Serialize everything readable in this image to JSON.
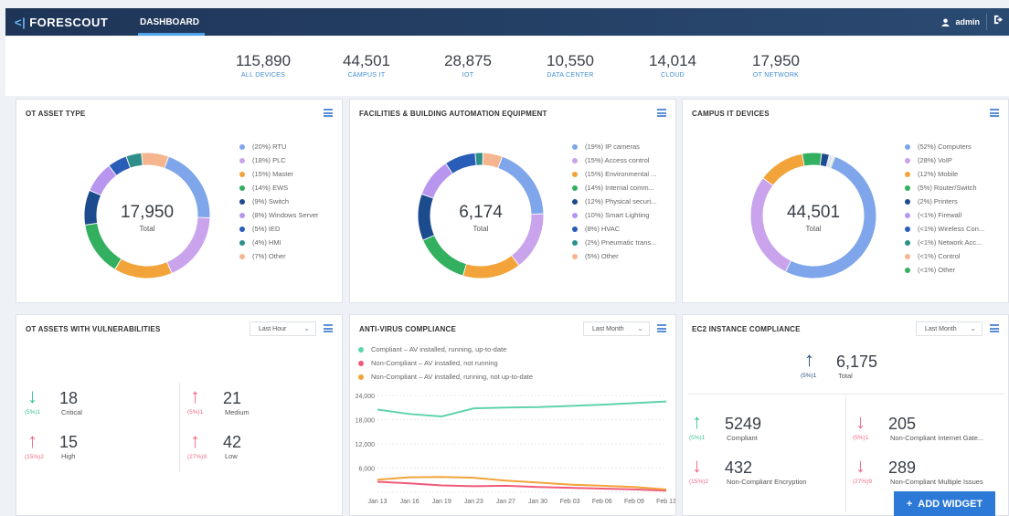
{
  "nav": {
    "brand": "FORESCOUT",
    "brand_glyph": "<|",
    "tab": "DASHBOARD",
    "user": "admin"
  },
  "stats": [
    {
      "value": "115,890",
      "label": "ALL DEVICES"
    },
    {
      "value": "44,501",
      "label": "CAMPUS IT"
    },
    {
      "value": "28,875",
      "label": "IOT"
    },
    {
      "value": "10,550",
      "label": "DATA CENTER"
    },
    {
      "value": "14,014",
      "label": "CLOUD"
    },
    {
      "value": "17,950",
      "label": "OT NETWORK"
    }
  ],
  "ot_asset": {
    "title": "OT ASSET TYPE",
    "total": "17,950",
    "total_label": "Total",
    "legend": [
      "(20%) RTU",
      "(18%) PLC",
      "(15%) Master",
      "(14%) EWS",
      "(9%) Switch",
      "(8%) Windows Server",
      "(5%) IED",
      "(4%) HMI",
      "(7%) Other"
    ],
    "values": [
      20,
      18,
      15,
      14,
      9,
      8,
      5,
      4,
      7
    ],
    "colors": [
      "#7fa6ea",
      "#c9a3ec",
      "#f2a43a",
      "#33b05f",
      "#1c4b8e",
      "#b895ee",
      "#2a5db8",
      "#2e8f8a",
      "#f5b58f"
    ]
  },
  "facilities": {
    "title": "FACILITIES & BUILDING AUTOMATION EQUIPMENT",
    "total": "6,174",
    "total_label": "Total",
    "legend": [
      "(19%) IP cameras",
      "(15%) Access control",
      "(15%) Environmental ...",
      "(14%) Internal comm...",
      "(12%) Physical securi...",
      "(10%) Smart Lighting",
      "(8%) HVAC",
      "(2%) Pneumatic trans...",
      "(5%) Other"
    ],
    "values": [
      19,
      15,
      15,
      14,
      12,
      10,
      8,
      2,
      5
    ],
    "colors": [
      "#7fa6ea",
      "#c9a3ec",
      "#f2a43a",
      "#33b05f",
      "#1c4b8e",
      "#b895ee",
      "#2a5db8",
      "#2e8f8a",
      "#f5b58f"
    ]
  },
  "campus": {
    "title": "CAMPUS IT DEVICES",
    "total": "44,501",
    "total_label": "Total",
    "legend": [
      "(52%) Computers",
      "(28%) VoIP",
      "(12%) Mobile",
      "(5%) Router/Switch",
      "(2%) Printers",
      "(<1%) Firewall",
      "(<1%) Wireless Con...",
      "(<1%) Network Acc...",
      "(<1%) Control",
      "(<1%) Other"
    ],
    "values": [
      52,
      28,
      12,
      5,
      2,
      0.3,
      0.3,
      0.3,
      0.3,
      0.3
    ],
    "colors": [
      "#7fa6ea",
      "#c9a3ec",
      "#f2a43a",
      "#33b05f",
      "#1c4b8e",
      "#b895ee",
      "#2a5db8",
      "#2e8f8a",
      "#f5b58f",
      "#33b05f"
    ]
  },
  "vuln": {
    "title": "OT ASSETS WITH VULNERABILITIES",
    "dropdown": "Last Hour",
    "items": [
      {
        "value": "18",
        "label": "Critical",
        "pct": "(5%)1",
        "dir": "down"
      },
      {
        "value": "21",
        "label": "Medium",
        "pct": "(5%)1",
        "dir": "up"
      },
      {
        "value": "15",
        "label": "High",
        "pct": "(15%)2",
        "dir": "up"
      },
      {
        "value": "42",
        "label": "Low",
        "pct": "(27%)9",
        "dir": "up"
      }
    ]
  },
  "av": {
    "title": "ANTI-VIRUS COMPLIANCE",
    "dropdown": "Last Month",
    "legend": [
      "Compliant – AV installed, running, up-to-date",
      "Non-Compliant – AV installed, not running",
      "Non-Compliant – AV installed, running, not up-to-date"
    ],
    "legend_colors": [
      "#5fd3a9",
      "#ef5b7a",
      "#f2a43a"
    ]
  },
  "chart_data": {
    "type": "line",
    "x": [
      "Jan 13",
      "Jan 16",
      "Jan 19",
      "Jan 23",
      "Jan 27",
      "Jan 30",
      "Feb 03",
      "Feb 06",
      "Feb 09",
      "Feb 13"
    ],
    "ylim": [
      0,
      24000
    ],
    "yticks": [
      "24,000",
      "18,000",
      "12,000",
      "6,000"
    ],
    "series": [
      {
        "values": [
          20500,
          19400,
          18800,
          20800,
          21000,
          21100,
          21400,
          21700,
          22100,
          22500
        ],
        "color": "#5fd3a9"
      },
      {
        "values": [
          2600,
          2200,
          1700,
          1500,
          1600,
          1300,
          1100,
          900,
          700,
          400
        ],
        "color": "#ef5b7a"
      },
      {
        "values": [
          3100,
          3700,
          3800,
          3600,
          2900,
          2400,
          1900,
          1600,
          1300,
          700
        ],
        "color": "#f2a43a"
      }
    ],
    "grid": true
  },
  "ec2": {
    "title": "EC2 INSTANCE COMPLIANCE",
    "dropdown": "Last Month",
    "total": "6,175",
    "total_label": "Total",
    "total_pct": "(5%)1",
    "items": [
      {
        "value": "5249",
        "label": "Compliant",
        "pct": "(5%)1",
        "dir": "up"
      },
      {
        "value": "205",
        "label": "Non-Compliant Internet Gate...",
        "pct": "(5%)1",
        "dir": "down"
      },
      {
        "value": "432",
        "label": "Non-Compliant Encryption",
        "pct": "(15%)2",
        "dir": "down"
      },
      {
        "value": "289",
        "label": "Non-Compliant Multiple Issues",
        "pct": "(27%)9",
        "dir": "down"
      }
    ]
  },
  "add_widget": "ADD WIDGET"
}
